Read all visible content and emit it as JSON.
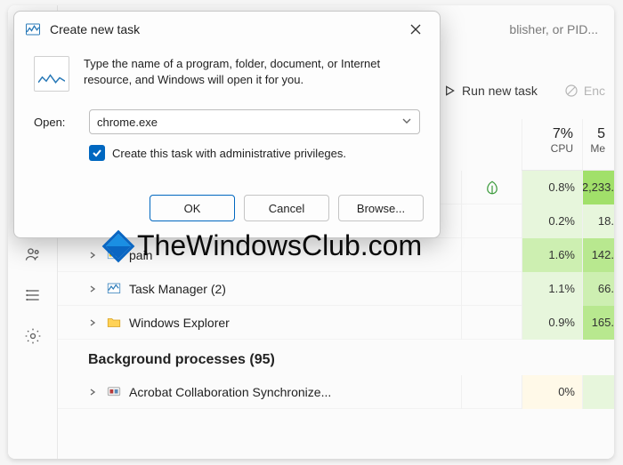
{
  "watermark": "TheWindowsClub.com",
  "search_placeholder_tail": "blisher, or PID...",
  "toolbar": {
    "run_new": "Run new task",
    "end_partial": "Enc"
  },
  "headers": {
    "cpu_pct": "7%",
    "cpu_label": "CPU",
    "mem_pct_partial": "5",
    "mem_label": "Me"
  },
  "rows": [
    {
      "name": "",
      "leaf": true,
      "cpu": "0.8%",
      "cpu_bg": "g1",
      "mem": "2,233.",
      "mem_bg": "g4"
    },
    {
      "name": "",
      "leaf": false,
      "cpu": "0.2%",
      "cpu_bg": "g1",
      "mem": "18.",
      "mem_bg": "g1"
    },
    {
      "name": "pain",
      "icon": "paint",
      "chev": true,
      "leaf": false,
      "cpu": "1.6%",
      "cpu_bg": "g2",
      "mem": "142.",
      "mem_bg": "g3"
    },
    {
      "name": "Task Manager (2)",
      "icon": "tm",
      "chev": true,
      "leaf": false,
      "cpu": "1.1%",
      "cpu_bg": "g1",
      "mem": "66.",
      "mem_bg": "g2"
    },
    {
      "name": "Windows Explorer",
      "icon": "folder",
      "chev": true,
      "leaf": false,
      "cpu": "0.9%",
      "cpu_bg": "g1",
      "mem": "165.",
      "mem_bg": "g3"
    }
  ],
  "section_bg": "Background processes (95)",
  "bg_rows": [
    {
      "name": "Acrobat Collaboration Synchronize...",
      "icon": "acrobat",
      "chev": true,
      "cpu": "0%",
      "cpu_bg": "g0",
      "mem": "",
      "mem_bg": "g1"
    }
  ],
  "dialog": {
    "title": "Create new task",
    "desc": "Type the name of a program, folder, document, or Internet resource, and Windows will open it for you.",
    "open_label": "Open:",
    "open_value": "chrome.exe",
    "admin_label": "Create this task with administrative privileges.",
    "ok": "OK",
    "cancel": "Cancel",
    "browse": "Browse..."
  }
}
